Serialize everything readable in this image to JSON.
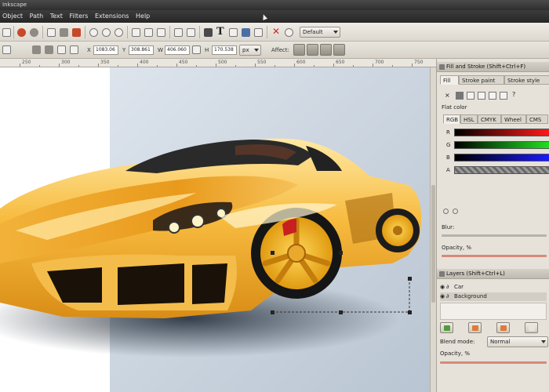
{
  "window": {
    "title": "Inkscape"
  },
  "menu": {
    "items": [
      "Object",
      "Path",
      "Text",
      "Filters",
      "Extensions",
      "Help"
    ]
  },
  "toolbar": {
    "preset_label": "Default",
    "affect_label": "Affect:"
  },
  "coords": {
    "x_label": "X",
    "x_value": "1083.06",
    "y_label": "Y",
    "y_value": "308.861",
    "w_label": "W",
    "w_value": "406.060",
    "h_label": "H",
    "h_value": "170.538",
    "units": "px"
  },
  "ruler": {
    "labels": [
      "250",
      "300",
      "350",
      "400",
      "450",
      "500",
      "550",
      "600",
      "650",
      "700",
      "750"
    ]
  },
  "fill_stroke": {
    "header": "Fill and Stroke (Shift+Ctrl+F)",
    "tabs": [
      "Fill",
      "Stroke paint",
      "Stroke style"
    ],
    "flat_color_label": "Flat color",
    "color_tabs": [
      "RGB",
      "HSL",
      "CMYK",
      "Wheel",
      "CMS"
    ],
    "channels": [
      "R",
      "G",
      "B",
      "A"
    ],
    "blur_label": "Blur:",
    "opacity_label": "Opacity, %"
  },
  "layers": {
    "header": "Layers (Shift+Ctrl+L)",
    "rows": [
      {
        "name": "Car"
      },
      {
        "name": "Background"
      }
    ],
    "blend_label": "Blend mode:",
    "blend_value": "Normal",
    "opacity_label": "Opacity, %"
  },
  "colors": {
    "car_body": "#f2b53b",
    "car_highlight": "#ffe69a",
    "canvas_bg": "#c7d1dd",
    "menu_bg": "#2f2f2f"
  }
}
